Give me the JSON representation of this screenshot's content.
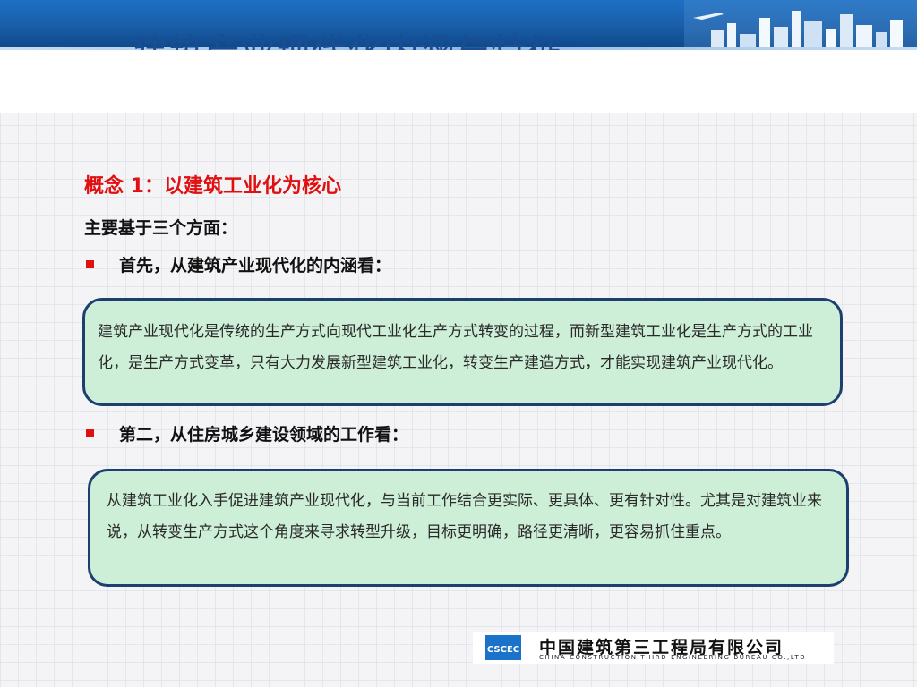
{
  "slide": {
    "title": "建筑产业现代化内涵与特征",
    "concept_heading": "概念 1：以建筑工业化为核心",
    "intro": "主要基于三个方面：",
    "points": [
      {
        "heading": "首先，从建筑产业现代化的内涵看：",
        "body": "建筑产业现代化是传统的生产方式向现代工业化生产方式转变的过程，而新型建筑工业化是生产方式的工业化，是生产方式变革，只有大力发展新型建筑工业化，转变生产建造方式，才能实现建筑产业现代化。"
      },
      {
        "heading": "第二，从住房城乡建设领域的工作看：",
        "body": "从建筑工业化入手促进建筑产业现代化，与当前工作结合更实际、更具体、更有针对性。尤其是对建筑业来说，从转变生产方式这个角度来寻求转型升级，目标更明确，路径更清晰，更容易抓住重点。"
      }
    ]
  },
  "logo": {
    "emblem_text": "CSCEC",
    "name_cn": "中国建筑第三工程局有限公司",
    "name_en": "CHINA CONSTRUCTION THIRD ENGINEERING BUREAU CO.,LTD"
  },
  "colors": {
    "banner": "#1a5ea8",
    "heading_red": "#e01010",
    "callout_fill": "#cdeed7",
    "callout_border": "#1d3f6e"
  }
}
